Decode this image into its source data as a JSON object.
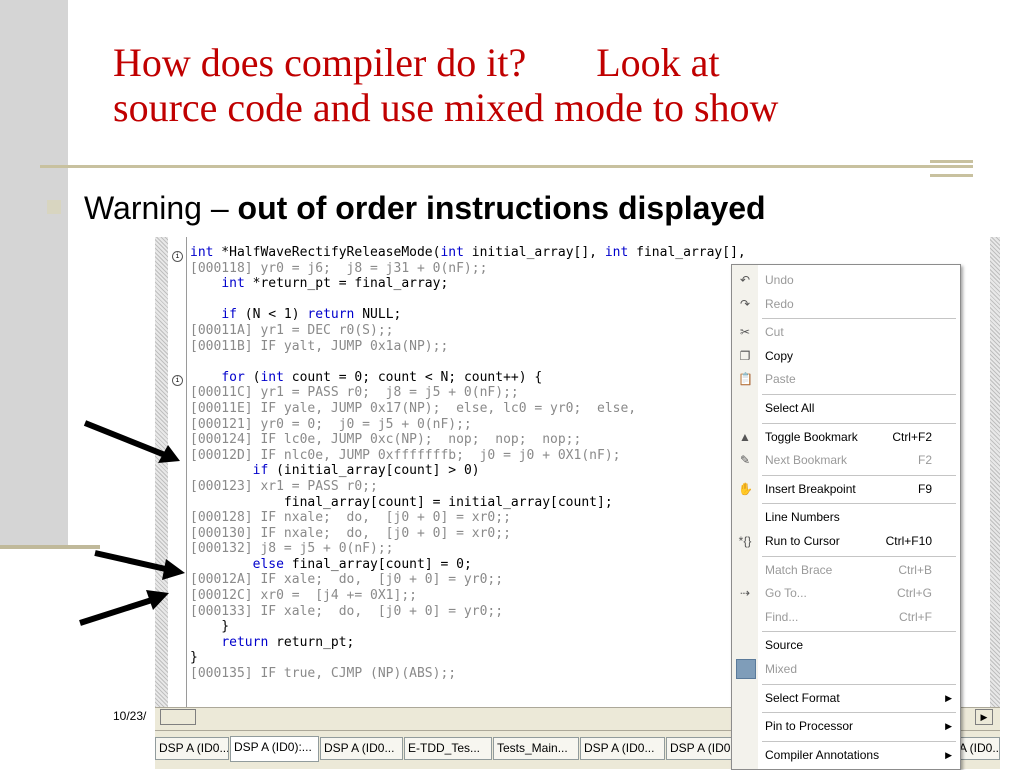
{
  "slide": {
    "title_part1": "How does compiler do it?",
    "title_part2": "Look at",
    "title_line2": "source code and use mixed mode to show",
    "bullet_prefix": "Warning – ",
    "bullet_bold": "out of order instructions displayed",
    "date": "10/23/",
    "title_color": "#c00000"
  },
  "code_lines": [
    {
      "t": "src",
      "text": "int *HalfWaveRectifyReleaseMode(int initial_array[], int final_array[], int N) {"
    },
    {
      "t": "asm",
      "text": "[000118] yr0 = j6;  j8 = j31 + 0(nF);;"
    },
    {
      "t": "src",
      "text": "    int *return_pt = final_array;"
    },
    {
      "t": "src",
      "text": ""
    },
    {
      "t": "src",
      "text": "    if (N < 1) return NULL;"
    },
    {
      "t": "asm",
      "text": "[00011A] yr1 = DEC r0(S);;"
    },
    {
      "t": "asm",
      "text": "[00011B] IF yalt, JUMP 0x1a(NP);;"
    },
    {
      "t": "src",
      "text": ""
    },
    {
      "t": "src",
      "text": "    for (int count = 0; count < N; count++) {"
    },
    {
      "t": "asm",
      "text": "[00011C] yr1 = PASS r0;  j8 = j5 + 0(nF);;"
    },
    {
      "t": "asm",
      "text": "[00011E] IF yale, JUMP 0x17(NP);  else, lc0 = yr0;  else,"
    },
    {
      "t": "asm",
      "text": "[000121] yr0 = 0;  j0 = j5 + 0(nF);;"
    },
    {
      "t": "asm",
      "text": "[000124] IF lc0e, JUMP 0xc(NP);  nop;  nop;  nop;;"
    },
    {
      "t": "asm",
      "text": "[00012D] IF nlc0e, JUMP 0xfffffffb;  j0 = j0 + 0X1(nF);"
    },
    {
      "t": "src",
      "text": "        if (initial_array[count] > 0)"
    },
    {
      "t": "asm",
      "text": "[000123] xr1 = PASS r0;;"
    },
    {
      "t": "src",
      "text": "            final_array[count] = initial_array[count];"
    },
    {
      "t": "asm",
      "text": "[000128] IF nxale;  do,  [j0 + 0] = xr0;;"
    },
    {
      "t": "asm",
      "text": "[000130] IF nxale;  do,  [j0 + 0] = xr0;;"
    },
    {
      "t": "asm",
      "text": "[000132] j8 = j5 + 0(nF);;"
    },
    {
      "t": "src",
      "text": "        else final_array[count] = 0;"
    },
    {
      "t": "asm",
      "text": "[00012A] IF xale;  do,  [j0 + 0] = yr0;;"
    },
    {
      "t": "asm",
      "text": "[00012C] xr0 =  [j4 += 0X1];;"
    },
    {
      "t": "asm",
      "text": "[000133] IF xale;  do,  [j0 + 0] = yr0;;"
    },
    {
      "t": "src",
      "text": "    }"
    },
    {
      "t": "src",
      "text": "    return return_pt;"
    },
    {
      "t": "src",
      "text": "}"
    },
    {
      "t": "asm",
      "text": "[000135] IF true, CJMP (NP)(ABS);;"
    }
  ],
  "tabs": [
    "DSP A (ID0...",
    "DSP A (ID0):...",
    "DSP A (ID0...",
    "E-TDD_Tes...",
    "Tests_Main...",
    "DSP A (ID0...",
    "DSP A (ID0...",
    "A (ID0..."
  ],
  "context_menu": {
    "items": [
      {
        "label": "Undo",
        "shortcut": "",
        "disabled": true,
        "icon": "undo-icon",
        "glyph": "↶"
      },
      {
        "label": "Redo",
        "shortcut": "",
        "disabled": true,
        "icon": "redo-icon",
        "glyph": "↷"
      },
      {
        "sep": true
      },
      {
        "label": "Cut",
        "shortcut": "",
        "disabled": true,
        "icon": "cut-icon",
        "glyph": "✂"
      },
      {
        "label": "Copy",
        "shortcut": "",
        "disabled": false,
        "icon": "copy-icon",
        "glyph": "❐"
      },
      {
        "label": "Paste",
        "shortcut": "",
        "disabled": true,
        "icon": "paste-icon",
        "glyph": "📋"
      },
      {
        "sep": true
      },
      {
        "label": "Select All",
        "shortcut": "",
        "disabled": false,
        "icon": "",
        "glyph": ""
      },
      {
        "sep": true
      },
      {
        "label": "Toggle Bookmark",
        "shortcut": "Ctrl+F2",
        "disabled": false,
        "icon": "bookmark-icon",
        "glyph": "▲"
      },
      {
        "label": "Next Bookmark",
        "shortcut": "F2",
        "disabled": true,
        "icon": "next-bookmark-icon",
        "glyph": "✎"
      },
      {
        "sep": true
      },
      {
        "label": "Insert Breakpoint",
        "shortcut": "F9",
        "disabled": false,
        "icon": "breakpoint-hand-icon",
        "glyph": "✋"
      },
      {
        "sep": true
      },
      {
        "label": "Line Numbers",
        "shortcut": "",
        "disabled": false,
        "icon": "",
        "glyph": ""
      },
      {
        "label": "Run to Cursor",
        "shortcut": "Ctrl+F10",
        "disabled": false,
        "icon": "run-to-cursor-icon",
        "glyph": "*{}"
      },
      {
        "sep": true
      },
      {
        "label": "Match Brace",
        "shortcut": "Ctrl+B",
        "disabled": true,
        "icon": "",
        "glyph": ""
      },
      {
        "label": "Go To...",
        "shortcut": "Ctrl+G",
        "disabled": true,
        "icon": "goto-icon",
        "glyph": "⇢"
      },
      {
        "label": "Find...",
        "shortcut": "Ctrl+F",
        "disabled": true,
        "icon": "",
        "glyph": ""
      },
      {
        "sep": true
      },
      {
        "label": "Source",
        "shortcut": "",
        "disabled": false,
        "icon": "",
        "glyph": ""
      },
      {
        "label": "Mixed",
        "shortcut": "",
        "disabled": true,
        "icon": "mixed-checked-icon",
        "glyph": ""
      },
      {
        "sep": true
      },
      {
        "label": "Select Format",
        "shortcut": "",
        "disabled": false,
        "icon": "",
        "glyph": "",
        "submenu": true
      },
      {
        "sep": true
      },
      {
        "label": "Pin to Processor",
        "shortcut": "",
        "disabled": false,
        "icon": "",
        "glyph": "",
        "submenu": true
      },
      {
        "sep": true
      },
      {
        "label": "Compiler Annotations",
        "shortcut": "",
        "disabled": false,
        "icon": "",
        "glyph": "",
        "submenu": true
      }
    ]
  }
}
